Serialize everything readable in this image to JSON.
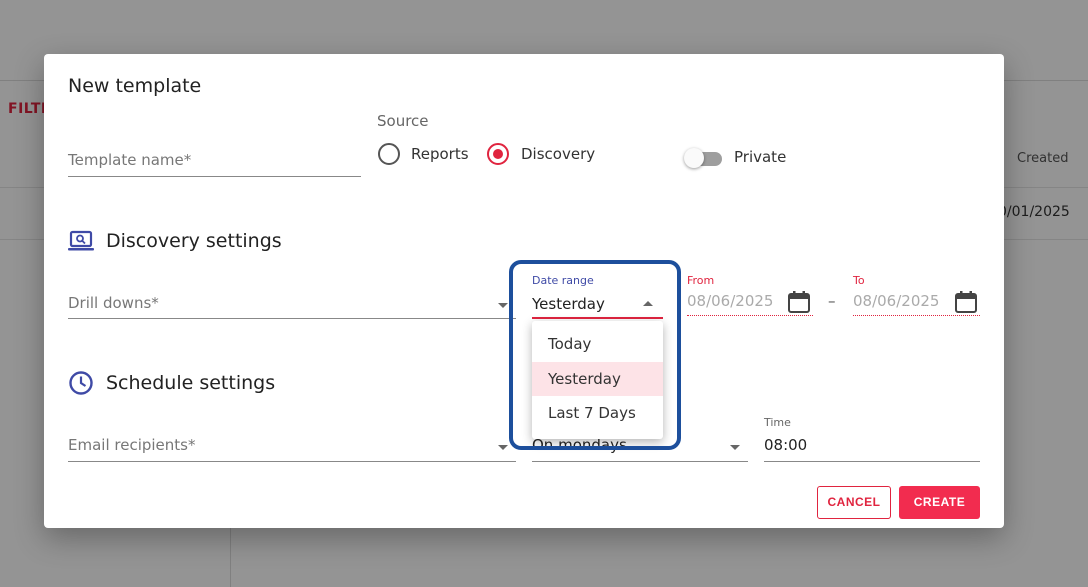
{
  "background": {
    "filter_label": "FILTE",
    "created_header": "Created",
    "created_value": "0/01/2025"
  },
  "dialog": {
    "title": "New template",
    "template_name_placeholder": "Template name*",
    "source_label": "Source",
    "source_options": [
      {
        "label": "Reports",
        "checked": false
      },
      {
        "label": "Discovery",
        "checked": true
      }
    ],
    "private_label": "Private",
    "private_on": false
  },
  "discovery": {
    "section_title": "Discovery settings",
    "section_icon": "laptop-search-icon",
    "drill_downs_placeholder": "Drill downs*",
    "date_range_label": "Date range",
    "date_range_value": "Yesterday",
    "from_label": "From",
    "from_value": "08/06/2025",
    "to_label": "To",
    "to_value": "08/06/2025",
    "range_separator": "–",
    "dropdown_options": [
      {
        "label": "Today",
        "selected": false
      },
      {
        "label": "Yesterday",
        "selected": true
      },
      {
        "label": "Last 7 Days",
        "selected": false
      }
    ]
  },
  "schedule": {
    "section_title": "Schedule settings",
    "section_icon": "clock-icon",
    "email_recipients_placeholder": "Email recipients*",
    "frequency_value": "On mondays",
    "time_label": "Time",
    "time_value": "08:00"
  },
  "actions": {
    "cancel_label": "CANCEL",
    "create_label": "CREATE"
  },
  "colors": {
    "accent": "#e0243f",
    "primary_button": "#f22c4f",
    "icon": "#3f4aa6",
    "highlight": "#1d4f9c"
  }
}
